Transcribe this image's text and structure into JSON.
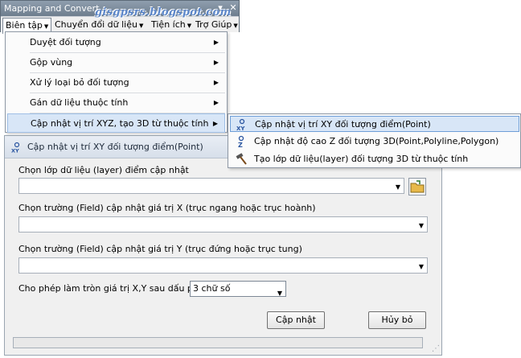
{
  "window_title": "Mapping and Convert",
  "watermark": "gisgpsrs.blogspot.com",
  "menubar": [
    {
      "label": "Biên tập"
    },
    {
      "label": "Chuyển đổi dữ liệu"
    },
    {
      "label": "Tiện ích"
    },
    {
      "label": "Trợ Giúp"
    }
  ],
  "dropdown": [
    {
      "label": "Duyệt đối tượng"
    },
    {
      "label": "Gộp vùng"
    },
    {
      "label": "Xử lý loại bỏ đối tượng"
    },
    {
      "label": "Gán dữ liệu thuộc tính"
    },
    {
      "label": "Cập nhật vị trí XYZ, tạo 3D từ thuộc tính"
    }
  ],
  "submenu": [
    {
      "label": "Cập nhật vị trí XY đối tượng điểm(Point)",
      "icon": "xy-point-icon"
    },
    {
      "label": "Cập nhật độ cao Z đối tượng 3D(Point,Polyline,Polygon)",
      "icon": "z-icon"
    },
    {
      "label": "Tạo lớp dữ liệu(layer) đối tượng 3D từ thuộc tính",
      "icon": "hammer-icon"
    }
  ],
  "dialog": {
    "title": "Cập nhật vị trí XY đối tượng điểm(Point)",
    "layer_label": "Chọn lớp dữ liệu (layer) điểm cập nhật",
    "field_x_label": "Chọn trường (Field) cập nhật giá trị X (trục ngang hoặc trục hoành)",
    "field_y_label": "Chọn trường (Field) cập nhật giá trị Y (trục đứng hoặc trục tung)",
    "rounding_label": "Cho phép làm tròn giá trị X,Y sau dấu phẩy",
    "rounding_value": "3 chữ số",
    "update_button": "Cập nhật",
    "cancel_button": "Hủy bỏ"
  }
}
